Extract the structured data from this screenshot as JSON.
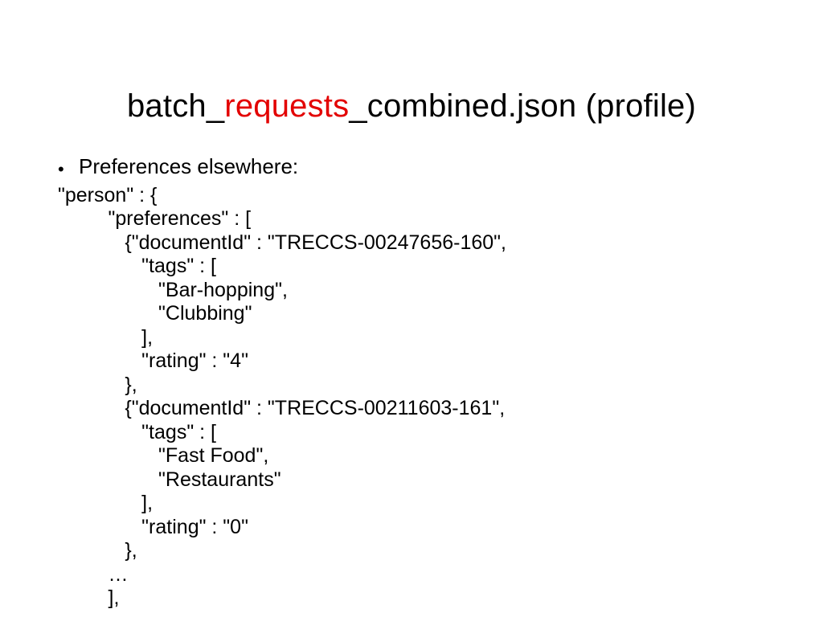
{
  "title": {
    "seg1": "batch_",
    "seg2": "requests",
    "seg3": "_combined.json (profile)"
  },
  "bullet": {
    "dot": "•",
    "text": "Preferences elsewhere:"
  },
  "code": "\"person\" : {\n         \"preferences\" : [\n            {\"documentId\" : \"TRECCS-00247656-160\",\n               \"tags\" : [\n                  \"Bar-hopping\",\n                  \"Clubbing\"\n               ],\n               \"rating\" : \"4\"\n            },\n            {\"documentId\" : \"TRECCS-00211603-161\",\n               \"tags\" : [\n                  \"Fast Food\",\n                  \"Restaurants\"\n               ],\n               \"rating\" : \"0\"\n            },\n         …\n         ],"
}
